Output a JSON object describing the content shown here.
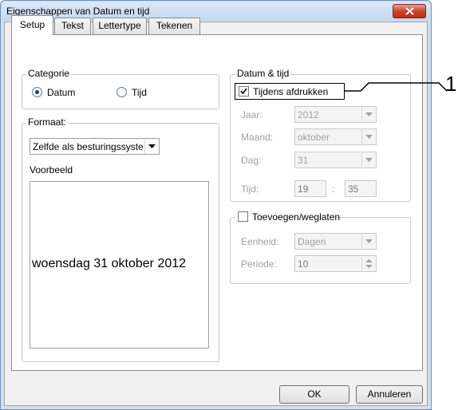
{
  "window": {
    "title": "Eigenschappen van Datum en tijd"
  },
  "tabs": [
    {
      "label": "Setup"
    },
    {
      "label": "Tekst"
    },
    {
      "label": "Lettertype"
    },
    {
      "label": "Tekenen"
    }
  ],
  "categorie": {
    "label": "Categorie",
    "options": [
      {
        "label": "Datum",
        "selected": true
      },
      {
        "label": "Tijd",
        "selected": false
      }
    ]
  },
  "formaat": {
    "label": "Formaat:",
    "selected": "Zelfde als besturingssyste",
    "preview_label": "Voorbeeld",
    "preview_text": "woensdag 31 oktober 2012"
  },
  "datum_tijd": {
    "label": "Datum & tijd",
    "print_checkbox": {
      "label": "Tijdens afdrukken",
      "checked": true
    },
    "jaar": {
      "label": "Jaar:",
      "value": "2012"
    },
    "maand": {
      "label": "Maand:",
      "value": "oktober"
    },
    "dag": {
      "label": "Dag:",
      "value": "31"
    },
    "tijd": {
      "label": "Tijd:",
      "hours": "19",
      "separator": ":",
      "minutes": "35"
    }
  },
  "toevoegen": {
    "label": "Toevoegen/weglaten",
    "checked": false,
    "eenheid": {
      "label": "Eenheid:",
      "value": "Dagen"
    },
    "periode": {
      "label": "Periode:",
      "value": "10"
    }
  },
  "buttons": {
    "ok": "OK",
    "cancel": "Annuleren"
  },
  "callout": {
    "number": "1"
  }
}
